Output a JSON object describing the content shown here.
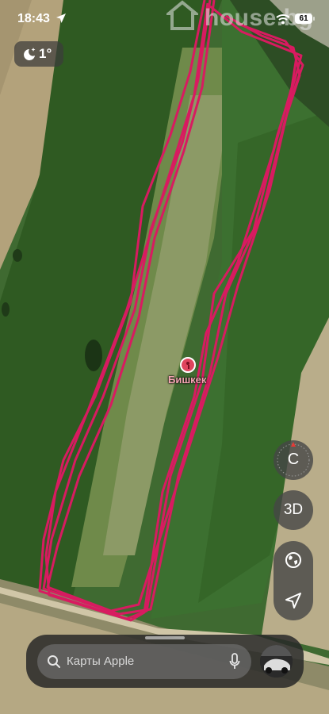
{
  "status_bar": {
    "time": "18:43",
    "battery": "61"
  },
  "watermark": {
    "text": "house.bg"
  },
  "weather": {
    "temperature": "1°",
    "icon": "moon-stars-icon"
  },
  "map": {
    "place_label": "Бишкек",
    "track_color": "#d81b60"
  },
  "controls": {
    "compass_letter": "С",
    "view_3d_label": "3D",
    "globe_icon": "globe-icon",
    "location_icon": "location-arrow-icon"
  },
  "search": {
    "placeholder": "Карты Apple"
  },
  "colors": {
    "accent_track": "#d81b60",
    "control_bg": "#464646"
  }
}
